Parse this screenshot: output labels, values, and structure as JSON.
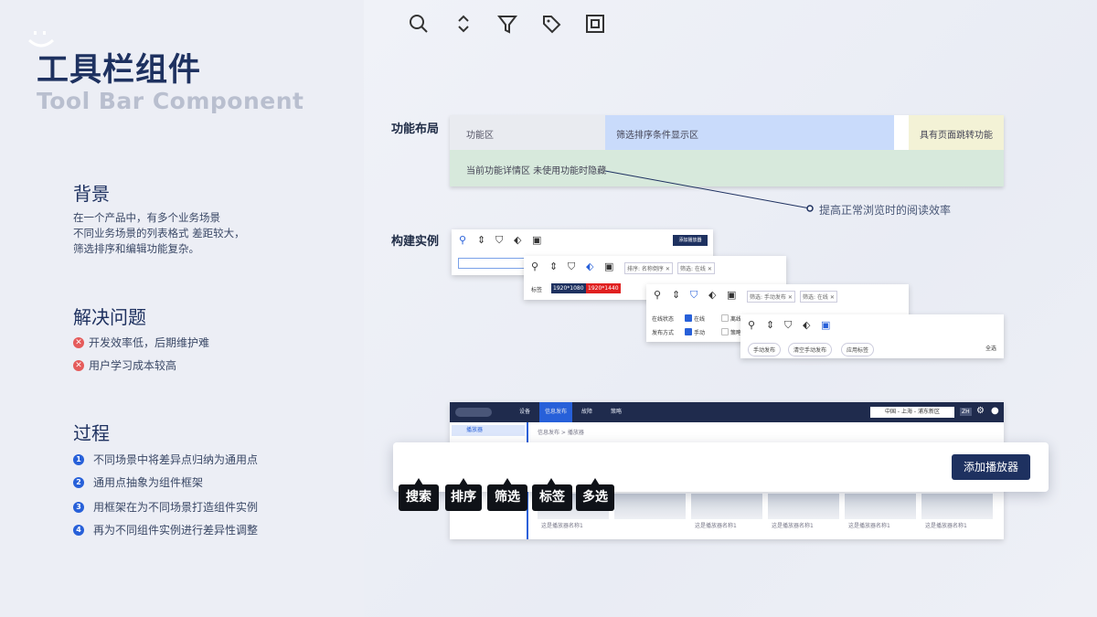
{
  "header": {
    "title_cn": "工具栏组件",
    "title_en": "Tool Bar Component"
  },
  "background": {
    "heading": "背景",
    "lines": [
      "在一个产品中，有多个业务场景",
      "不同业务场景的列表格式 差距较大，",
      "筛选排序和编辑功能复杂。"
    ]
  },
  "problems": {
    "heading": "解决问题",
    "items": [
      "开发效率低，后期维护难",
      "用户学习成本较高"
    ]
  },
  "process": {
    "heading": "过程",
    "steps": [
      "不同场景中将差异点归纳为通用点",
      "通用点抽象为组件框架",
      "用框架在为不同场景打造组件实例",
      "再为不同组件实例进行差异性调整"
    ]
  },
  "layout_section": {
    "label": "功能布局",
    "zone_function": "功能区",
    "zone_filter": "筛选排序条件显示区",
    "zone_jump": "具有页面跳转功能",
    "zone_detail": "当前功能详情区  未使用功能时隐藏",
    "note": "提高正常浏览时的阅读效率"
  },
  "instances_section": {
    "label": "构建实例",
    "card1": {
      "button": "添加播放器"
    },
    "card2": {
      "chip_sort": "排序: 名称倒序",
      "chip_filter": "筛选: 在线",
      "row_label": "标签",
      "tag1": "1920*1080",
      "tag2": "1920*1440"
    },
    "card3": {
      "chip1": "筛选: 手动发布",
      "chip2": "筛选: 在线",
      "row1_label": "在线状态",
      "row1_opt1": "在线",
      "row1_opt2": "离线",
      "row2_label": "发布方式",
      "row2_opt1": "手动",
      "row2_opt2": "策略"
    },
    "card4": {
      "btn1": "手动发布",
      "btn2": "清空手动发布",
      "btn3": "应用标签",
      "select_all": "全选"
    }
  },
  "app": {
    "nav": [
      "设备",
      "信息发布",
      "故障",
      "策略"
    ],
    "location": "中国 - 上海 - 浦东新区",
    "lang": "ZH",
    "sidebar_item": "播放器",
    "breadcrumb": "信息发布 > 播放器",
    "captions": [
      "这是播放器名称1",
      "这是播放器名称1",
      "这是播放器名称1",
      "这是播放器名称1",
      "这是播放器名称1"
    ]
  },
  "toolbar": {
    "button": "添加播放器",
    "labels": [
      "搜索",
      "排序",
      "筛选",
      "标签",
      "多选"
    ]
  },
  "colors": {
    "primary": "#1e3160",
    "accent": "#2760d9",
    "error": "#e55b5b",
    "tag_blue": "#1e3160",
    "tag_red": "#e02020"
  }
}
